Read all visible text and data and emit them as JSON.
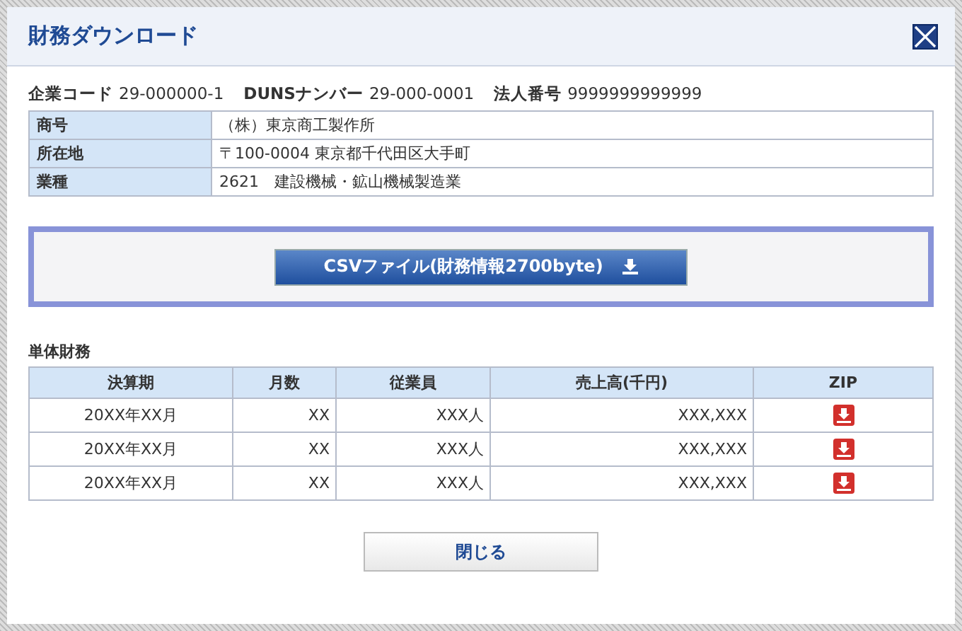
{
  "window": {
    "title": "財務ダウンロード"
  },
  "ids": [
    {
      "label": "企業コード",
      "value": "29-000000-1"
    },
    {
      "label": "DUNSナンバー",
      "value": "29-000-0001"
    },
    {
      "label": "法人番号",
      "value": "9999999999999"
    }
  ],
  "company": [
    {
      "label": "商号",
      "value": "（株）東京商工製作所"
    },
    {
      "label": "所在地",
      "value": "〒100-0004 東京都千代田区大手町"
    },
    {
      "label": "業種",
      "value": "2621　建設機械・鉱山機械製造業"
    }
  ],
  "csv_button": "CSVファイル(財務情報2700byte)",
  "section_title": "単体財務",
  "table": {
    "columns": [
      "決算期",
      "月数",
      "従業員",
      "売上高(千円)",
      "ZIP"
    ],
    "rows": [
      [
        "20XX年XX月",
        "XX",
        "XXX人",
        "XXX,XXX"
      ],
      [
        "20XX年XX月",
        "XX",
        "XXX人",
        "XXX,XXX"
      ],
      [
        "20XX年XX月",
        "XX",
        "XXX人",
        "XXX,XXX"
      ]
    ]
  },
  "close_button": "閉じる"
}
